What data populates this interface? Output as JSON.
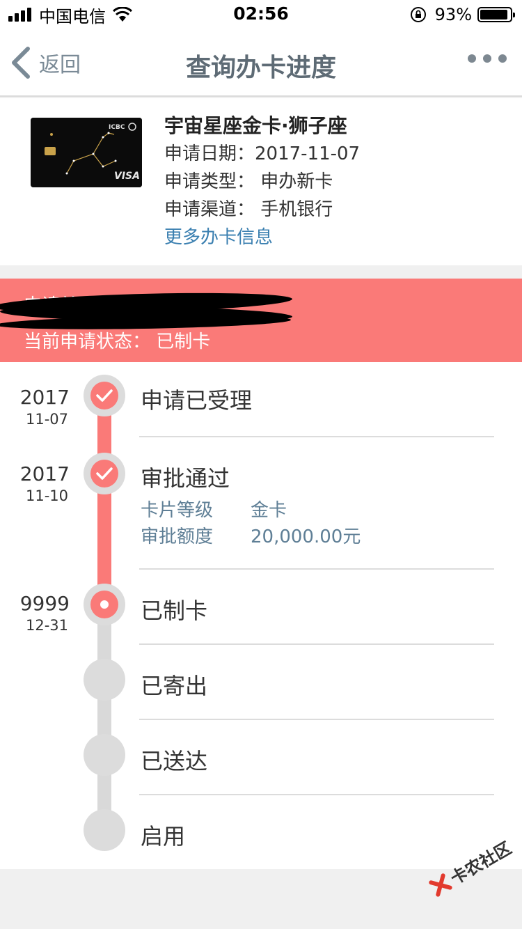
{
  "status_bar": {
    "carrier": "中国电信",
    "time": "02:56",
    "battery_pct": "93%",
    "battery_level": 0.93
  },
  "nav": {
    "back_label": "返回",
    "title": "查询办卡进度"
  },
  "card": {
    "name": "宇宙星座金卡·狮子座",
    "apply_date": "申请日期：2017-11-07",
    "apply_type": "申请类型：  申办新卡",
    "apply_channel": "申请渠道：  手机银行",
    "more_info": "更多办卡信息",
    "brand_bank": "ICBC",
    "brand_network": "VISA"
  },
  "banner": {
    "line1": "申请单",
    "line2": "当前申请状态：  已制卡"
  },
  "timeline": {
    "steps": [
      {
        "year": "2017",
        "day": "11-07",
        "label": "申请已受理",
        "state": "done"
      },
      {
        "year": "2017",
        "day": "11-10",
        "label": "审批通过",
        "state": "done",
        "details": [
          {
            "key": "卡片等级",
            "value": "金卡"
          },
          {
            "key": "审批额度",
            "value": "20,000.00元"
          }
        ]
      },
      {
        "year": "9999",
        "day": "12-31",
        "label": "已制卡",
        "state": "current"
      },
      {
        "year": "",
        "day": "",
        "label": "已寄出",
        "state": "pending"
      },
      {
        "year": "",
        "day": "",
        "label": "已送达",
        "state": "pending"
      },
      {
        "year": "",
        "day": "",
        "label": "启用",
        "state": "pending"
      }
    ]
  },
  "watermark": "卡农社区",
  "colors": {
    "accent": "#fa7a78",
    "link": "#3a7fb0",
    "title": "#5e6b75",
    "track": "#d9d9d9"
  }
}
